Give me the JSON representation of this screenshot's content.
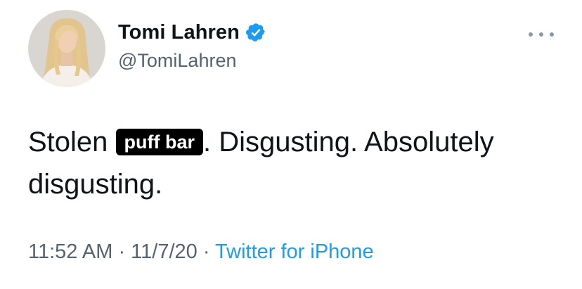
{
  "author": {
    "display_name": "Tomi Lahren",
    "handle": "@TomiLahren",
    "verified": true,
    "verified_icon": "verified-badge-icon",
    "avatar": "profile-photo"
  },
  "tweet": {
    "text_before": "Stolen ",
    "redaction_label": "puff bar",
    "text_after": ". Disgusting. Absolutely disgusting."
  },
  "meta": {
    "time": "11:52 AM",
    "separator": " · ",
    "date": "11/7/20",
    "source": "Twitter for iPhone"
  },
  "menu_icon": "more-options-icon",
  "colors": {
    "text": "#0f1419",
    "secondary": "#536471",
    "link": "#1d9bf0",
    "verified": "#1d9bf0",
    "redaction_bg": "#000000"
  }
}
